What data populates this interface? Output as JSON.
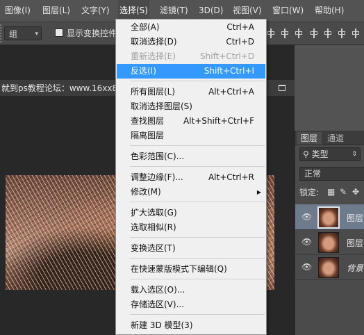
{
  "menubar": {
    "items": [
      {
        "label": "图像(I)"
      },
      {
        "label": "图层(L)"
      },
      {
        "label": "文字(Y)"
      },
      {
        "label": "选择(S)",
        "active": true
      },
      {
        "label": "滤镜(T)"
      },
      {
        "label": "3D(D)"
      },
      {
        "label": "视图(V)"
      },
      {
        "label": "窗口(W)"
      },
      {
        "label": "帮助(H)"
      }
    ]
  },
  "options_bar": {
    "auto_select_value": "组",
    "show_transform_label": "显示变换控件"
  },
  "document": {
    "title": "就到ps教程论坛：www.16xx8"
  },
  "select_menu": {
    "items": [
      {
        "label": "全部(A)",
        "shortcut": "Ctrl+A"
      },
      {
        "label": "取消选择(D)",
        "shortcut": "Ctrl+D"
      },
      {
        "label": "重新选择(E)",
        "shortcut": "Shift+Ctrl+D",
        "disabled": true
      },
      {
        "label": "反选(I)",
        "shortcut": "Shift+Ctrl+I",
        "highlighted": true
      },
      {
        "separator": true
      },
      {
        "label": "所有图层(L)",
        "shortcut": "Alt+Ctrl+A"
      },
      {
        "label": "取消选择图层(S)",
        "shortcut": ""
      },
      {
        "label": "查找图层",
        "shortcut": "Alt+Shift+Ctrl+F"
      },
      {
        "label": "隔离图层",
        "shortcut": ""
      },
      {
        "separator": true
      },
      {
        "label": "色彩范围(C)...",
        "shortcut": ""
      },
      {
        "separator": true
      },
      {
        "label": "调整边缘(F)...",
        "shortcut": "Alt+Ctrl+R"
      },
      {
        "label": "修改(M)",
        "shortcut": "",
        "submenu": true
      },
      {
        "separator": true
      },
      {
        "label": "扩大选取(G)",
        "shortcut": ""
      },
      {
        "label": "选取相似(R)",
        "shortcut": ""
      },
      {
        "separator": true
      },
      {
        "label": "变换选区(T)",
        "shortcut": ""
      },
      {
        "separator": true
      },
      {
        "label": "在快速蒙版模式下编辑(Q)",
        "shortcut": ""
      },
      {
        "separator": true
      },
      {
        "label": "载入选区(O)...",
        "shortcut": ""
      },
      {
        "label": "存储选区(V)...",
        "shortcut": ""
      },
      {
        "separator": true
      },
      {
        "label": "新建 3D 模型(3)",
        "shortcut": ""
      }
    ]
  },
  "layers_panel": {
    "tabs": [
      {
        "label": "图层",
        "active": true
      },
      {
        "label": "通道",
        "active": false
      }
    ],
    "filter_label": "类型",
    "blend_mode": "正常",
    "lock_label": "锁定:",
    "layers": [
      {
        "name": "图层",
        "selected": true,
        "italic": false
      },
      {
        "name": "图层",
        "selected": false,
        "italic": false
      },
      {
        "name": "背景",
        "selected": false,
        "italic": true
      }
    ]
  }
}
